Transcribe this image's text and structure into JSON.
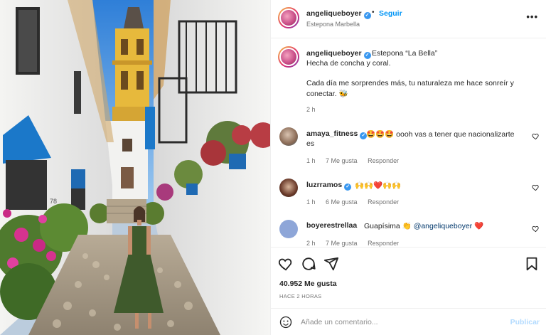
{
  "post": {
    "username": "angeliqueboyer",
    "follow_label": "Seguir",
    "location": "Estepona Marbella",
    "more_label": "•••"
  },
  "caption": {
    "username": "angeliqueboyer",
    "title": "Estepona “La Bella”",
    "line1": "Hecha de concha y coral.",
    "line2": "Cada día me sorprendes más, tu naturaleza me hace sonreír y",
    "line3": "conectar. 🐝",
    "time": "2 h"
  },
  "comments": [
    {
      "username": "amaya_fitness",
      "verified": true,
      "text_line1": "🤩🤩🤩 oooh vas a tener que nacionalizarte",
      "text_line2": "es",
      "time": "1 h",
      "likes": "7 Me gusta",
      "reply": "Responder"
    },
    {
      "username": "luzrramos",
      "verified": true,
      "text_line1": "🙌🙌❤️🙌🙌",
      "time": "1 h",
      "likes": "6 Me gusta",
      "reply": "Responder"
    },
    {
      "username": "boyerestrellaa",
      "verified": false,
      "text_before": "Guapísima 👏",
      "mention": "@angeliqueboyer",
      "text_after": "❤️",
      "time": "2 h",
      "likes": "7 Me gusta",
      "reply": "Responder"
    }
  ],
  "stats": {
    "likes": "40.952 Me gusta",
    "time_ago": "HACE 2 HORAS"
  },
  "add_comment": {
    "placeholder": "Añade un comentario...",
    "publish": "Publicar"
  },
  "photo_text": {
    "wall_number": "78"
  },
  "colors": {
    "accent": "#0095f6",
    "verified": "#3897f0",
    "like_red": "#ed4956",
    "publish_disabled": "#b3dbff"
  },
  "icons": [
    "heart-icon",
    "comment-icon",
    "share-icon",
    "bookmark-icon",
    "smile-icon",
    "more-icon",
    "verified-icon"
  ]
}
